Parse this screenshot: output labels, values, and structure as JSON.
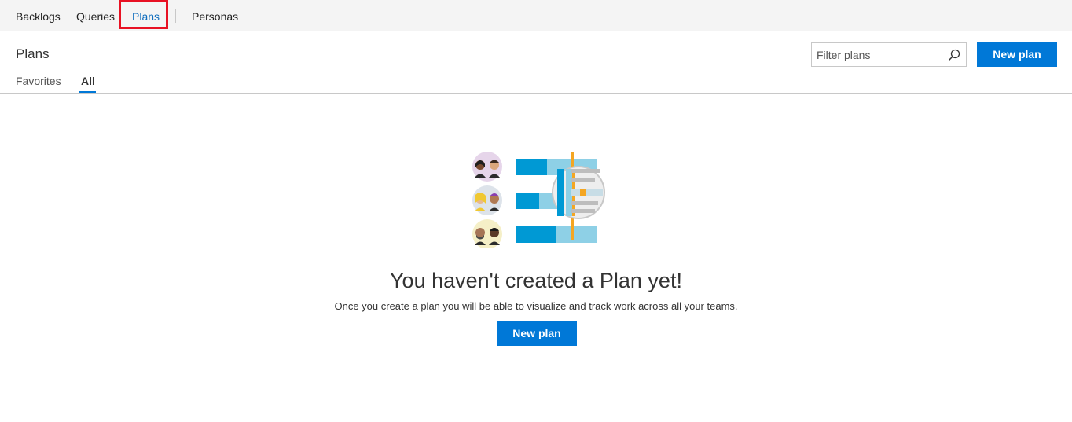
{
  "topnav": {
    "items": [
      {
        "label": "Backlogs",
        "active": false
      },
      {
        "label": "Queries",
        "active": false
      },
      {
        "label": "Plans",
        "active": true
      },
      {
        "label": "Personas",
        "active": false
      }
    ]
  },
  "header": {
    "title": "Plans",
    "pivots": [
      {
        "label": "Favorites",
        "selected": false
      },
      {
        "label": "All",
        "selected": true
      }
    ],
    "filter": {
      "placeholder": "Filter plans",
      "value": ""
    },
    "new_plan_label": "New plan"
  },
  "empty_state": {
    "title": "You haven't created a Plan yet!",
    "subtitle": "Once you create a plan you will be able to visualize and track work across all your teams.",
    "button_label": "New plan"
  },
  "colors": {
    "accent": "#0078d7",
    "active_nav": "#106ebe",
    "highlight": "#e81123",
    "nav_bg": "#f4f4f4"
  }
}
